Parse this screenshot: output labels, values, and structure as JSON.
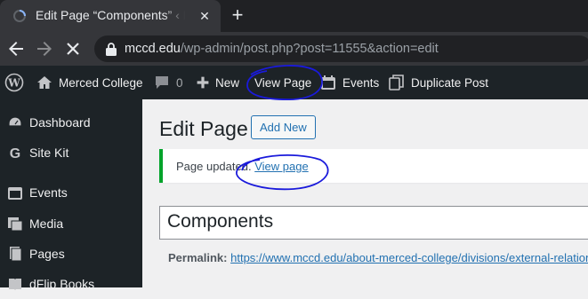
{
  "browser": {
    "tab_title": "Edit Page “Components” ‹ Merced College",
    "tab_close": "✕",
    "new_tab": "+",
    "url_host": "mccd.edu",
    "url_path": "/wp-admin/post.php?post=11555&action=edit"
  },
  "adminbar": {
    "site_name": "Merced College",
    "comments_count": "0",
    "new_label": "New",
    "view_page_label": "View Page",
    "events_label": "Events",
    "duplicate_label": "Duplicate Post"
  },
  "sidebar": {
    "items": [
      {
        "label": "Dashboard",
        "icon": "dashboard-icon"
      },
      {
        "label": "Site Kit",
        "icon": "google-g-icon"
      },
      {
        "label": "Events",
        "icon": "calendar-icon"
      },
      {
        "label": "Media",
        "icon": "media-icon"
      },
      {
        "label": "Pages",
        "icon": "pages-icon"
      },
      {
        "label": "dFlip Books",
        "icon": "book-icon"
      }
    ]
  },
  "main": {
    "page_title": "Edit Page",
    "add_new_label": "Add New",
    "notice_text": "Page updated.",
    "notice_link": "View page",
    "post_title": "Components",
    "permalink_label": "Permalink:",
    "permalink_url": "https://www.mccd.edu/about-merced-college/divisions/external-relations/"
  },
  "colors": {
    "accent": "#2271b1",
    "success": "#00a32a",
    "annotation": "#1a1adb"
  }
}
